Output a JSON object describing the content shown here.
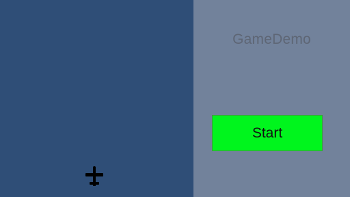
{
  "game": {
    "title": "GameDemo"
  },
  "menu": {
    "start_label": "Start"
  },
  "player": {
    "icon": "airplane-icon"
  },
  "colors": {
    "play_area_background": "#2f4e77",
    "side_panel_background": "#72829b",
    "start_button": "#00f51d",
    "title_text": "#5e6675"
  }
}
